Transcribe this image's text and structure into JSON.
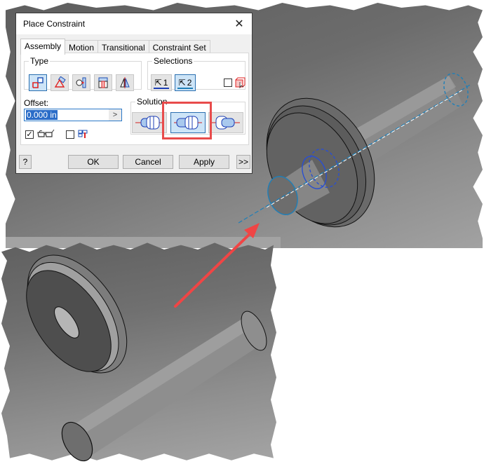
{
  "dialog": {
    "title": "Place Constraint",
    "close_icon": "close-icon",
    "tabs": [
      {
        "label": "Assembly",
        "active": true
      },
      {
        "label": "Motion",
        "active": false
      },
      {
        "label": "Transitional",
        "active": false
      },
      {
        "label": "Constraint Set",
        "active": false
      }
    ],
    "type_group": {
      "label": "Type",
      "buttons": [
        {
          "icon": "mate-constraint-icon",
          "active": true
        },
        {
          "icon": "angle-constraint-icon",
          "active": false
        },
        {
          "icon": "tangent-constraint-icon",
          "active": false
        },
        {
          "icon": "insert-constraint-icon",
          "active": false
        },
        {
          "icon": "symmetry-constraint-icon",
          "active": false
        }
      ]
    },
    "selections_group": {
      "label": "Selections",
      "buttons": [
        {
          "label": "1",
          "icon": "select-cursor-icon",
          "active": false
        },
        {
          "label": "2",
          "icon": "select-cursor-icon",
          "active": true
        }
      ],
      "pick_part_first": {
        "checked": false,
        "icon": "pick-part-first-icon"
      }
    },
    "offset": {
      "label": "Offset:",
      "value": "0.000 in",
      "arrow": ">"
    },
    "show_preview": {
      "checked": true,
      "icon": "glasses-preview-icon",
      "check_mark": "✓"
    },
    "predict_offset": {
      "checked": false,
      "icon": "predict-offset-icon"
    },
    "solution_group": {
      "label": "Solution",
      "buttons": [
        {
          "icon": "insert-opposed-icon",
          "active": false
        },
        {
          "icon": "insert-aligned-icon",
          "active": true
        },
        {
          "icon": "insert-locked-icon",
          "active": false
        }
      ]
    },
    "footer": {
      "help_icon": "help-icon",
      "ok_label": "OK",
      "cancel_label": "Cancel",
      "apply_label": "Apply",
      "more_label": ">>"
    }
  },
  "annotation": {
    "highlight_color": "#e84b4b",
    "arrow_color": "#f04545"
  },
  "viewport": {
    "assembled_view": "shaft-inserted-into-pulley",
    "initial_view": "shaft-and-pulley-separate",
    "selection_color": "#1f7fb8"
  }
}
